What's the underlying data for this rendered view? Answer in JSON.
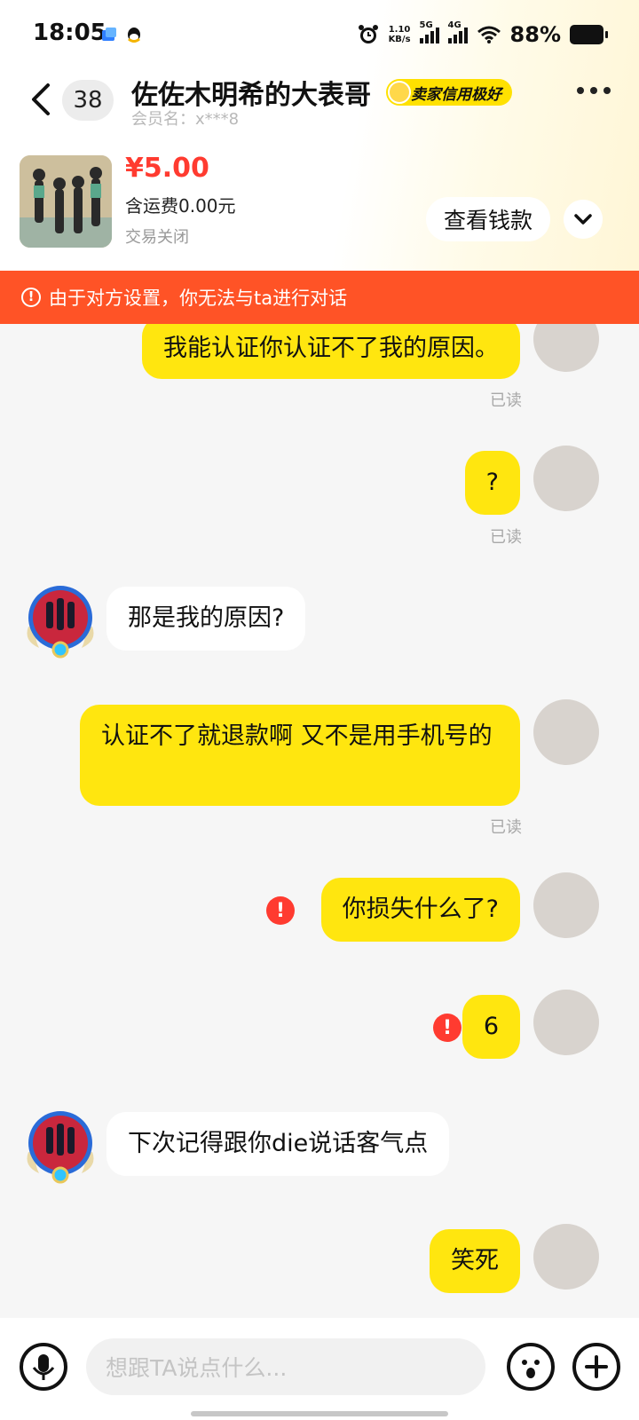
{
  "status_bar": {
    "time": "18:05",
    "net_speed_top": "1.10",
    "net_speed_unit": "KB/s",
    "sig1": "5G",
    "sig2": "4G",
    "battery": "88%"
  },
  "header": {
    "unread_count": "38",
    "title": "佐佐木明希的大表哥",
    "credit_badge": "卖家信用极好",
    "member_label": "会员名：x***8"
  },
  "product": {
    "price": "¥5.00",
    "shipping": "含运费0.00元",
    "status": "交易关闭",
    "view_button": "查看钱款"
  },
  "warning": {
    "text": "由于对方设置，你无法与ta进行对话"
  },
  "messages": [
    {
      "from": "me",
      "text": "我能认证你认证不了我的原因。",
      "read": "已读"
    },
    {
      "from": "me",
      "text": "?",
      "read": "已读"
    },
    {
      "from": "other",
      "text": "那是我的原因?"
    },
    {
      "from": "me",
      "text": "认证不了就退款啊 又不是用手机号的",
      "read": "已读"
    },
    {
      "from": "me",
      "text": "你损失什么了?",
      "failed": true
    },
    {
      "from": "me",
      "text": "6",
      "failed": true
    },
    {
      "from": "other",
      "text": "下次记得跟你die说话客气点"
    },
    {
      "from": "me",
      "text": "笑死"
    }
  ],
  "input": {
    "placeholder": "想跟TA说点什么..."
  },
  "colors": {
    "accent_yellow": "#ffe60f",
    "warning_bg": "#ff5326",
    "price_red": "#ff3b30"
  },
  "icons": [
    "back-icon",
    "more-icon",
    "chevron-down-icon",
    "mic-icon",
    "emoji-icon",
    "plus-icon",
    "alert-icon",
    "error-icon"
  ]
}
